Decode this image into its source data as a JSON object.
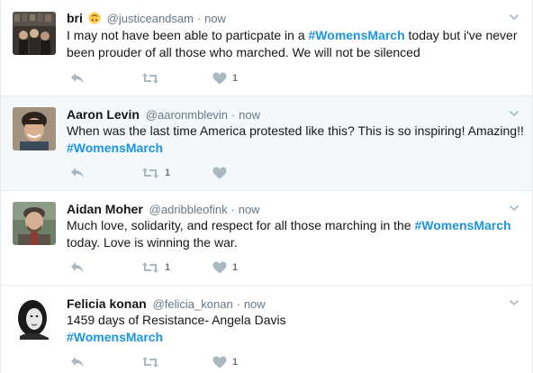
{
  "tweets": [
    {
      "name": "bri",
      "emoji": "upside-down-face-emoji",
      "handle": "@justiceandsam",
      "separator": "·",
      "time": "now",
      "text_parts": [
        "I may not have been able to particpate in a ",
        "#WomensMarch",
        " today but i've never been prouder of all those who marched. We will not be silenced"
      ],
      "retweets": "",
      "likes": "1",
      "highlighted": false
    },
    {
      "name": "Aaron Levin",
      "handle": "@aaronmblevin",
      "separator": "·",
      "time": "now",
      "text_parts": [
        "When was the last time America protested like this? This is so inspiring! Amazing!! ",
        "#WomensMarch",
        ""
      ],
      "retweets": "1",
      "likes": "",
      "highlighted": true
    },
    {
      "name": "Aidan Moher",
      "handle": "@adribbleofink",
      "separator": "·",
      "time": "now",
      "text_parts": [
        "Much love, solidarity, and respect for all those marching in the ",
        "#WomensMarch",
        " today. Love is winning the war."
      ],
      "retweets": "1",
      "likes": "1",
      "highlighted": false
    },
    {
      "name": "Felicia konan",
      "handle": "@felicia_konan",
      "separator": "·",
      "time": "now",
      "text_parts": [
        "1459 days of Resistance- Angela Davis ",
        "#WomensMarch",
        ""
      ],
      "retweets": "",
      "likes": "1",
      "highlighted": false
    }
  ],
  "icons": {
    "reply": "reply-icon",
    "retweet": "retweet-icon",
    "like": "heart-icon",
    "more": "chevron-down-icon"
  },
  "colors": {
    "hashtag": "#1b95e0",
    "icon_gray": "#aab8c2",
    "meta_gray": "#657786",
    "highlight_bg": "#f5f8fa"
  }
}
